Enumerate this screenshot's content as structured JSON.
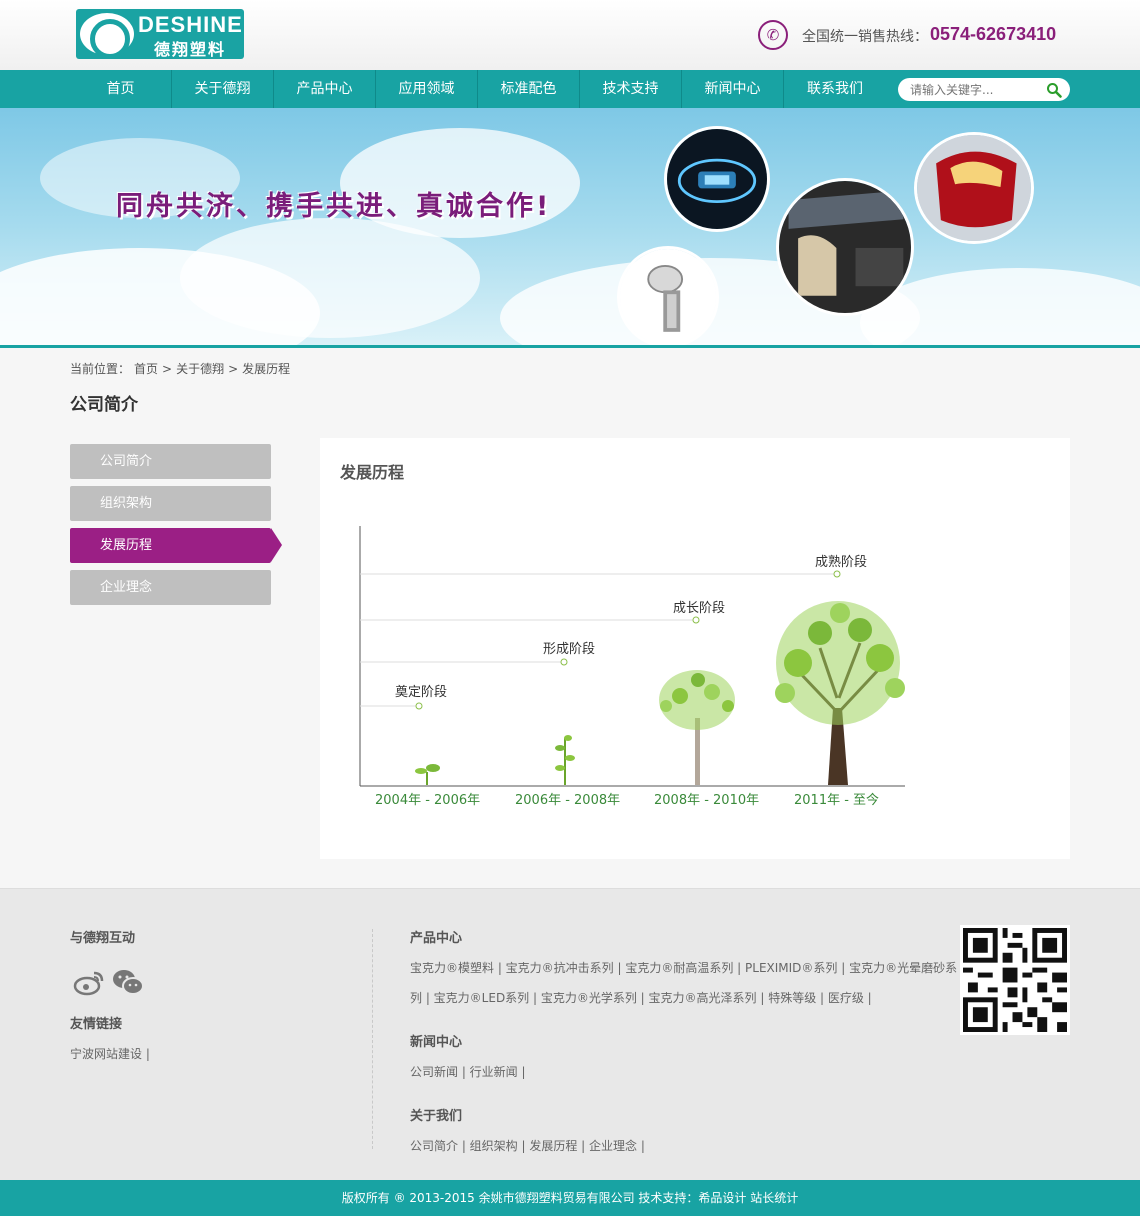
{
  "header": {
    "logo_en": "DESHINE",
    "logo_cn": "德翔塑料",
    "hotline_label": "全国统一销售热线：",
    "hotline_number": "0574-62673410"
  },
  "nav": {
    "items": [
      "首页",
      "关于德翔",
      "产品中心",
      "应用领域",
      "标准配色",
      "技术支持",
      "新闻中心",
      "联系我们"
    ],
    "search_placeholder": "请输入关键字..."
  },
  "banner": {
    "slogan": "同舟共济、携手共进、真诚合作!"
  },
  "breadcrumb": {
    "prefix": "当前位置：",
    "items": [
      "首页",
      "关于德翔",
      "发展历程"
    ],
    "separator": ">"
  },
  "page_title": "公司简介",
  "side_menu": {
    "items": [
      "公司简介",
      "组织架构",
      "发展历程",
      "企业理念"
    ],
    "active": "发展历程"
  },
  "content": {
    "title": "发展历程",
    "stages": [
      {
        "label": "奠定阶段",
        "period": "2004年 - 2006年"
      },
      {
        "label": "形成阶段",
        "period": "2006年 - 2008年"
      },
      {
        "label": "成长阶段",
        "period": "2008年 - 2010年"
      },
      {
        "label": "成熟阶段",
        "period": "2011年 - 至今"
      }
    ]
  },
  "footer": {
    "interact_title": "与德翔互动",
    "friend_links_title": "友情链接",
    "friend_links": "宁波网站建设 |",
    "products_title": "产品中心",
    "products_line1": "宝克力®模塑料 | 宝克力®抗冲击系列 | 宝克力®耐高温系列 | PLEXIMID®系列 | 宝克力®光晕磨砂系",
    "products_line2": "列 | 宝克力®LED系列 | 宝克力®光学系列 | 宝克力®高光泽系列 | 特殊等级 | 医疗级 |",
    "news_title": "新闻中心",
    "news_links": "公司新闻 | 行业新闻 |",
    "about_title": "关于我们",
    "about_links": "公司简介 | 组织架构 | 发展历程 | 企业理念 |",
    "copyright": "版权所有 ® 2013-2015 余姚市德翔塑料贸易有限公司 技术支持：希品设计 站长统计"
  },
  "colors": {
    "teal": "#18a3a3",
    "purple": "#9b1f85",
    "gray_menu": "#bfbfbf"
  }
}
